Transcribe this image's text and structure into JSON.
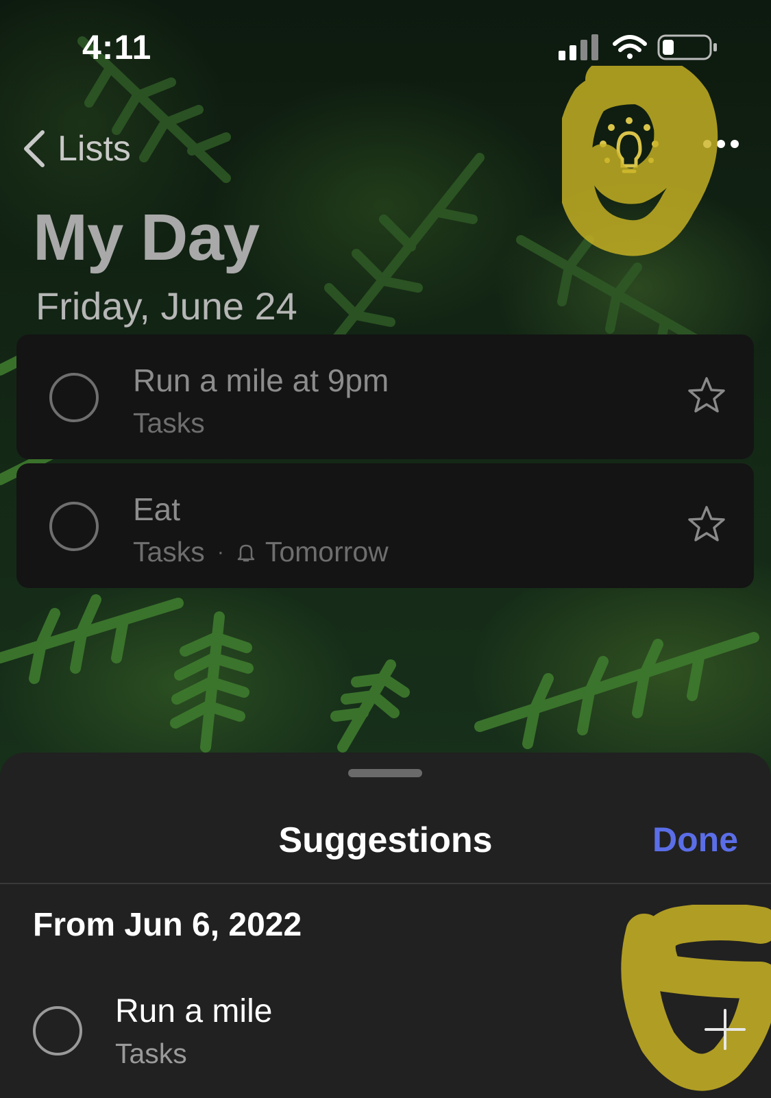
{
  "status_bar": {
    "time": "4:11"
  },
  "header": {
    "back_label": "Lists"
  },
  "page": {
    "title": "My Day",
    "date": "Friday, June 24"
  },
  "tasks": [
    {
      "title": "Run a mile at 9pm",
      "list": "Tasks"
    },
    {
      "title": "Eat",
      "list": "Tasks",
      "separator": "·",
      "reminder": "Tomorrow"
    }
  ],
  "sheet": {
    "title": "Suggestions",
    "done_label": "Done",
    "section_header": "From Jun 6, 2022",
    "items": [
      {
        "title": "Run a mile",
        "list": "Tasks"
      }
    ]
  },
  "colors": {
    "accent": "#5b6ee8",
    "annotation": "#c9b324"
  },
  "icons": [
    "back-chevron-icon",
    "lightbulb-icon",
    "more-icon",
    "star-icon",
    "bell-icon",
    "plus-icon",
    "wifi-icon",
    "signal-icon",
    "battery-icon"
  ]
}
